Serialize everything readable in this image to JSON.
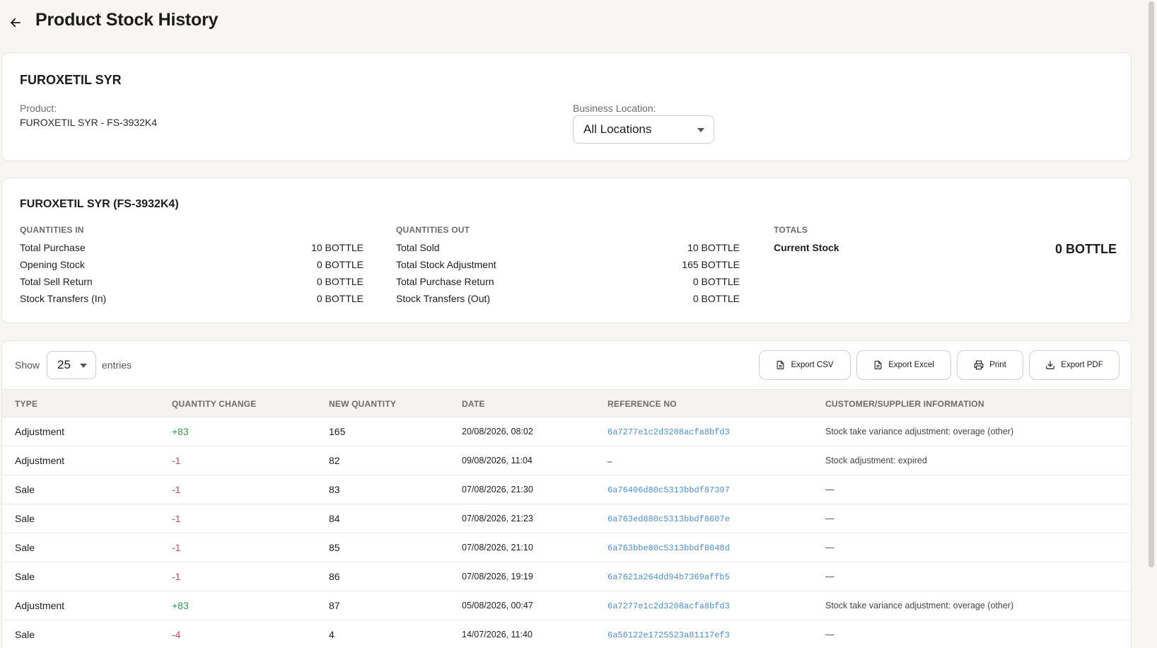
{
  "header": {
    "title": "Product Stock History"
  },
  "product_card": {
    "name": "FUROXETIL SYR",
    "product_label": "Product:",
    "product_value": "FUROXETIL SYR - FS-3932K4",
    "location_label": "Business Location:",
    "location_value": "All Locations"
  },
  "summary": {
    "title": "FUROXETIL SYR (FS-3932K4)",
    "in_heading": "QUANTITIES IN",
    "out_heading": "QUANTITIES OUT",
    "totals_heading": "TOTALS",
    "in": [
      {
        "label": "Total Purchase",
        "value": "10 BOTTLE"
      },
      {
        "label": "Opening Stock",
        "value": "0 BOTTLE"
      },
      {
        "label": "Total Sell Return",
        "value": "0 BOTTLE"
      },
      {
        "label": "Stock Transfers (In)",
        "value": "0 BOTTLE"
      }
    ],
    "out": [
      {
        "label": "Total Sold",
        "value": "10 BOTTLE"
      },
      {
        "label": "Total Stock Adjustment",
        "value": "165 BOTTLE"
      },
      {
        "label": "Total Purchase Return",
        "value": "0 BOTTLE"
      },
      {
        "label": "Stock Transfers (Out)",
        "value": "0 BOTTLE"
      }
    ],
    "current_stock_label": "Current Stock",
    "current_stock_value": "0 BOTTLE"
  },
  "table": {
    "show_label": "Show",
    "entries_value": "25",
    "entries_label": "entries",
    "buttons": {
      "csv": "Export CSV",
      "excel": "Export Excel",
      "print": "Print",
      "pdf": "Export PDF"
    },
    "columns": [
      "TYPE",
      "QUANTITY CHANGE",
      "NEW QUANTITY",
      "DATE",
      "REFERENCE NO",
      "CUSTOMER/SUPPLIER INFORMATION"
    ],
    "rows": [
      {
        "type": "Adjustment",
        "change": "+83",
        "sign": "pos",
        "new_qty": "165",
        "date": "20/08/2026, 08:02",
        "ref": "6a7277e1c2d3208acfa8bfd3",
        "info": "Stock take variance adjustment: overage (other)"
      },
      {
        "type": "Adjustment",
        "change": "-1",
        "sign": "neg",
        "new_qty": "82",
        "date": "09/08/2026, 11:04",
        "ref": "–",
        "info": "Stock adjustment: expired"
      },
      {
        "type": "Sale",
        "change": "-1",
        "sign": "neg",
        "new_qty": "83",
        "date": "07/08/2026, 21:30",
        "ref": "6a76406d80c5313bbdf87397",
        "info": "—"
      },
      {
        "type": "Sale",
        "change": "-1",
        "sign": "neg",
        "new_qty": "84",
        "date": "07/08/2026, 21:23",
        "ref": "6a763ed880c5313bbdf8607e",
        "info": "—"
      },
      {
        "type": "Sale",
        "change": "-1",
        "sign": "neg",
        "new_qty": "85",
        "date": "07/08/2026, 21:10",
        "ref": "6a763bbe80c5313bbdf8048d",
        "info": "—"
      },
      {
        "type": "Sale",
        "change": "-1",
        "sign": "neg",
        "new_qty": "86",
        "date": "07/08/2026, 19:19",
        "ref": "6a7621a264dd94b7369affb5",
        "info": "—"
      },
      {
        "type": "Adjustment",
        "change": "+83",
        "sign": "pos",
        "new_qty": "87",
        "date": "05/08/2026, 00:47",
        "ref": "6a7277e1c2d3208acfa8bfd3",
        "info": "Stock take variance adjustment: overage (other)"
      },
      {
        "type": "Sale",
        "change": "-4",
        "sign": "neg",
        "new_qty": "4",
        "date": "14/07/2026, 11:40",
        "ref": "6a56122e1725523a81117ef3",
        "info": "—"
      }
    ]
  },
  "colors": {
    "positive": "#2e9a4f",
    "negative": "#d64545",
    "link": "#4a8fd6",
    "background": "#f7f6f3"
  },
  "icons": {
    "back": "arrow-left-icon",
    "csv": "file-icon",
    "excel": "file-icon",
    "print": "printer-icon",
    "pdf": "download-icon"
  }
}
